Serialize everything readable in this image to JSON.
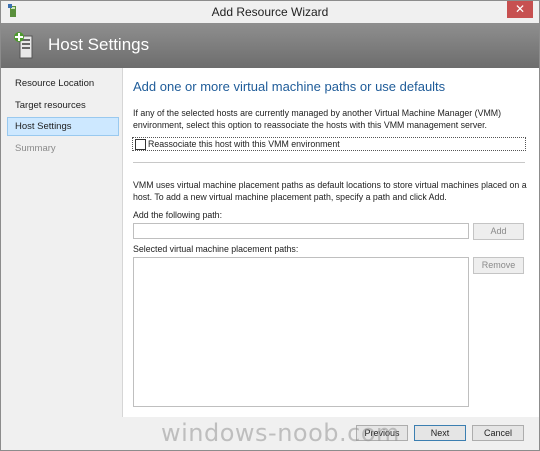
{
  "window": {
    "title": "Add Resource Wizard",
    "close_glyph": "✕"
  },
  "header": {
    "title": "Host Settings",
    "icon": "server-settings-icon"
  },
  "nav": {
    "items": [
      {
        "label": "Resource Location",
        "state": "normal"
      },
      {
        "label": "Target resources",
        "state": "normal"
      },
      {
        "label": "Host Settings",
        "state": "active"
      },
      {
        "label": "Summary",
        "state": "disabled"
      }
    ]
  },
  "content": {
    "heading": "Add one or more virtual machine paths or use defaults",
    "intro": "If any of the selected hosts are currently managed by another Virtual Machine Manager (VMM) environment, select this option to reassociate the hosts with this VMM management server.",
    "reassociate_label": "Reassociate this host with this VMM environment",
    "reassociate_checked": false,
    "vmm_text": "VMM uses virtual machine placement paths as default locations to store virtual machines placed on a host. To add a new virtual machine placement path, specify a path and click Add.",
    "add_path_label": "Add the following path:",
    "add_path_value": "",
    "add_button": "Add",
    "selected_paths_label": "Selected virtual machine placement paths:",
    "selected_paths": [],
    "remove_button": "Remove"
  },
  "footer": {
    "previous": "Previous",
    "next": "Next",
    "cancel": "Cancel"
  },
  "watermark": "windows-noob.com",
  "colors": {
    "heading": "#1f5c99",
    "header_bg": "#7a7a7a",
    "close_bg": "#c75050",
    "active_nav": "#cde8ff"
  }
}
